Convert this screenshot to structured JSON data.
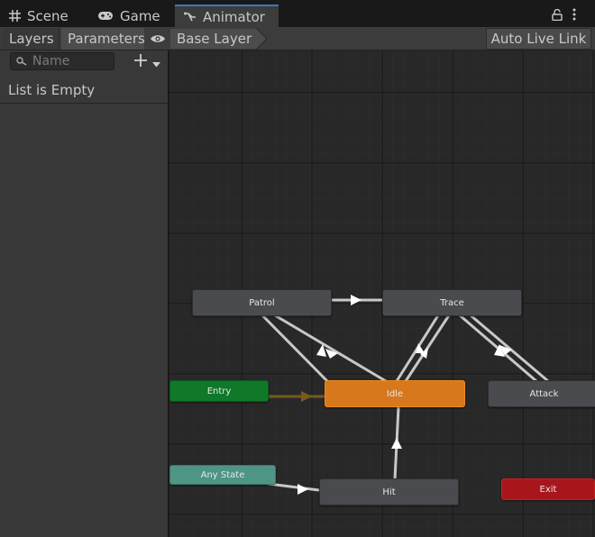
{
  "tabs": [
    {
      "label": "Scene",
      "icon": "grid-icon"
    },
    {
      "label": "Game",
      "icon": "gamepad-icon"
    },
    {
      "label": "Animator",
      "icon": "animator-icon",
      "active": true
    }
  ],
  "toolbar": {
    "layers_label": "Layers",
    "parameters_label": "Parameters",
    "breadcrumb": "Base Layer",
    "auto_live_link_label": "Auto Live Link"
  },
  "parameters_panel": {
    "search_placeholder": "Name",
    "empty_text": "List is Empty"
  },
  "graph": {
    "states": {
      "patrol": "Patrol",
      "trace": "Trace",
      "entry": "Entry",
      "idle": "Idle",
      "attack": "Attack",
      "any_state": "Any State",
      "hit": "Hit",
      "exit": "Exit"
    }
  },
  "colors": {
    "accent": "#3a79bb",
    "default_state": "#d6781b",
    "entry": "#107829",
    "any_state": "#4e9487",
    "exit": "#a8161c",
    "state": "#4a4b4e"
  }
}
